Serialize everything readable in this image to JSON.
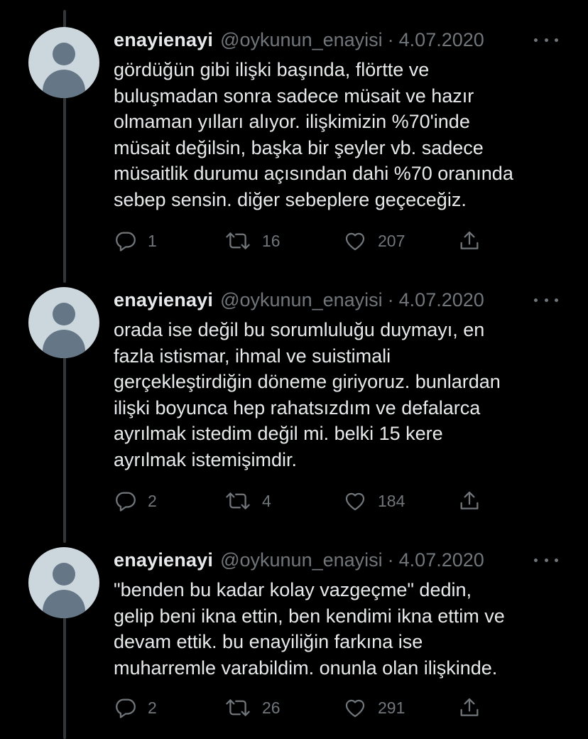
{
  "tweets": [
    {
      "name": "enayienayi",
      "handle": "@oykunun_enayisi",
      "separator": "·",
      "date": "4.07.2020",
      "text": "gördüğün gibi ilişki başında, flörtte ve\nbuluşmadan sonra sadece müsait ve hazır\nolmaman yılları alıyor. ilişkimizin %70'inde\nmüsait değilsin, başka bir şeyler vb. sadece\nmüsaitlik durumu açısından dahi %70 oranında\nsebep sensin. diğer sebeplere geçeceğiz.",
      "replies": "1",
      "retweets": "16",
      "likes": "207"
    },
    {
      "name": "enayienayi",
      "handle": "@oykunun_enayisi",
      "separator": "·",
      "date": "4.07.2020",
      "text": "orada ise değil bu sorumluluğu duymayı, en\nfazla istismar, ihmal ve suistimali\ngerçekleştirdiğin döneme giriyoruz. bunlardan\nilişki boyunca hep rahatsızdım ve defalarca\nayrılmak istedim değil mi. belki 15 kere\nayrılmak istemişimdir.",
      "replies": "2",
      "retweets": "4",
      "likes": "184"
    },
    {
      "name": "enayienayi",
      "handle": "@oykunun_enayisi",
      "separator": "·",
      "date": "4.07.2020",
      "text": "\"benden bu kadar kolay vazgeçme\" dedin,\ngelip beni ikna ettin, ben kendimi ikna ettim ve\ndevam ettik. bu enayiliğin farkına ise\nmuharremle varabildim. onunla olan ilişkinde.",
      "replies": "2",
      "retweets": "26",
      "likes": "291"
    }
  ],
  "icons": {
    "reply": "reply-icon",
    "retweet": "retweet-icon",
    "like": "heart-icon",
    "share": "share-icon",
    "more": "more-icon"
  },
  "colors": {
    "background": "#000000",
    "text": "#e7e9ea",
    "secondary": "#71767b",
    "thread_line": "#333639"
  }
}
